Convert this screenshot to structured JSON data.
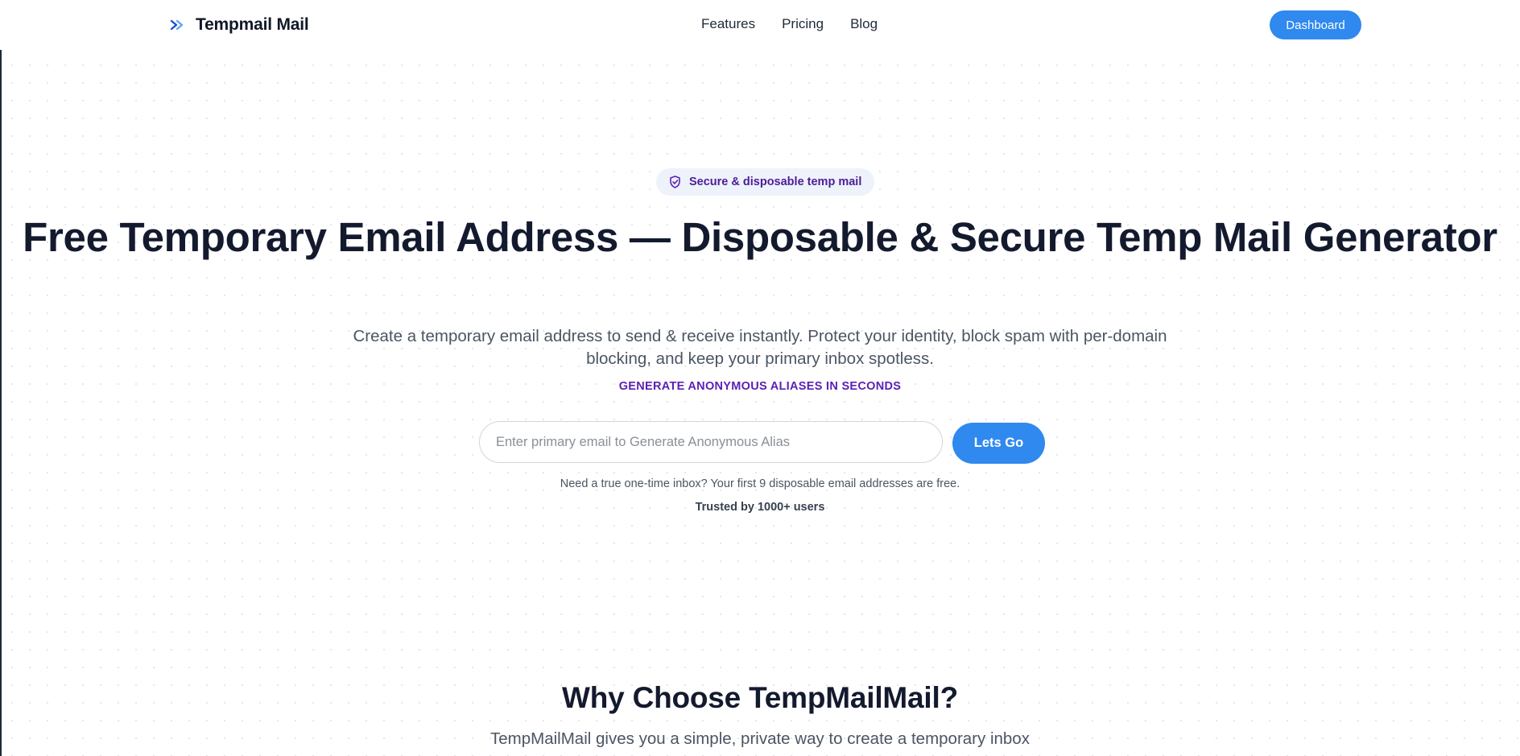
{
  "header": {
    "brand_name": "Tempmail Mail",
    "brand_icon": "double-chevron-right-icon",
    "nav": [
      {
        "label": "Features"
      },
      {
        "label": "Pricing"
      },
      {
        "label": "Blog"
      }
    ],
    "dashboard_label": "Dashboard"
  },
  "hero": {
    "badge_icon": "shield-check-icon",
    "badge_text": "Secure & disposable temp mail",
    "title": "Free Temporary Email Address — Disposable & Secure Temp Mail Generator",
    "subtitle": "Create a temporary email address to send & receive instantly. Protect your identity, block spam with per-domain blocking, and keep your primary inbox spotless.",
    "tagline": "GENERATE ANONYMOUS ALIASES IN SECONDS",
    "input_placeholder": "Enter primary email to Generate Anonymous Alias",
    "input_value": "",
    "cta_label": "Lets Go",
    "note": "Need a true one-time inbox? Your first 9 disposable email addresses are free.",
    "trusted": "Trusted by 1000+ users"
  },
  "why": {
    "title": "Why Choose TempMailMail?",
    "subtitle": "TempMailMail gives you a simple, private way to create a temporary inbox"
  },
  "colors": {
    "accent": "#2f89ee",
    "tagline": "#5b21b6",
    "heading": "#141a2e",
    "badge_bg": "#eef2fb"
  }
}
